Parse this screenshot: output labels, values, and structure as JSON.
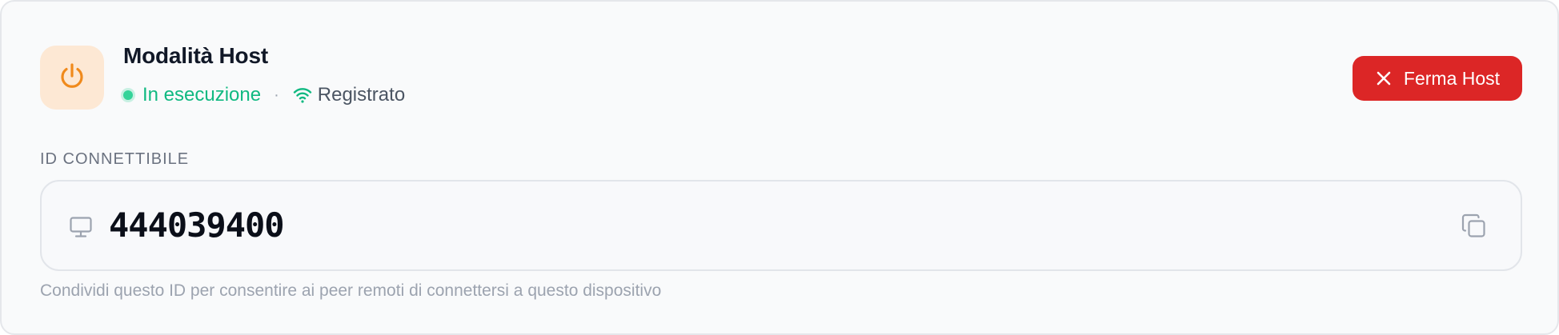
{
  "host": {
    "title": "Modalità Host",
    "status_text": "In esecuzione",
    "separator": "·",
    "registration_text": "Registrato",
    "stop_button_label": "Ferma Host"
  },
  "connectable_id": {
    "label": "ID CONNETTIBILE",
    "value": "444039400",
    "hint": "Condividi questo ID per consentire ai peer remoti di connettersi a questo dispositivo"
  },
  "icons": {
    "power": "power-icon",
    "wifi": "wifi-icon",
    "close": "close-icon",
    "monitor": "monitor-icon",
    "copy": "copy-icon"
  },
  "colors": {
    "accent_orange": "#f08a1c",
    "accent_orange_bg": "#fde8d4",
    "status_green": "#10b981",
    "danger_red": "#dc2626",
    "card_bg": "#f9fafb"
  }
}
